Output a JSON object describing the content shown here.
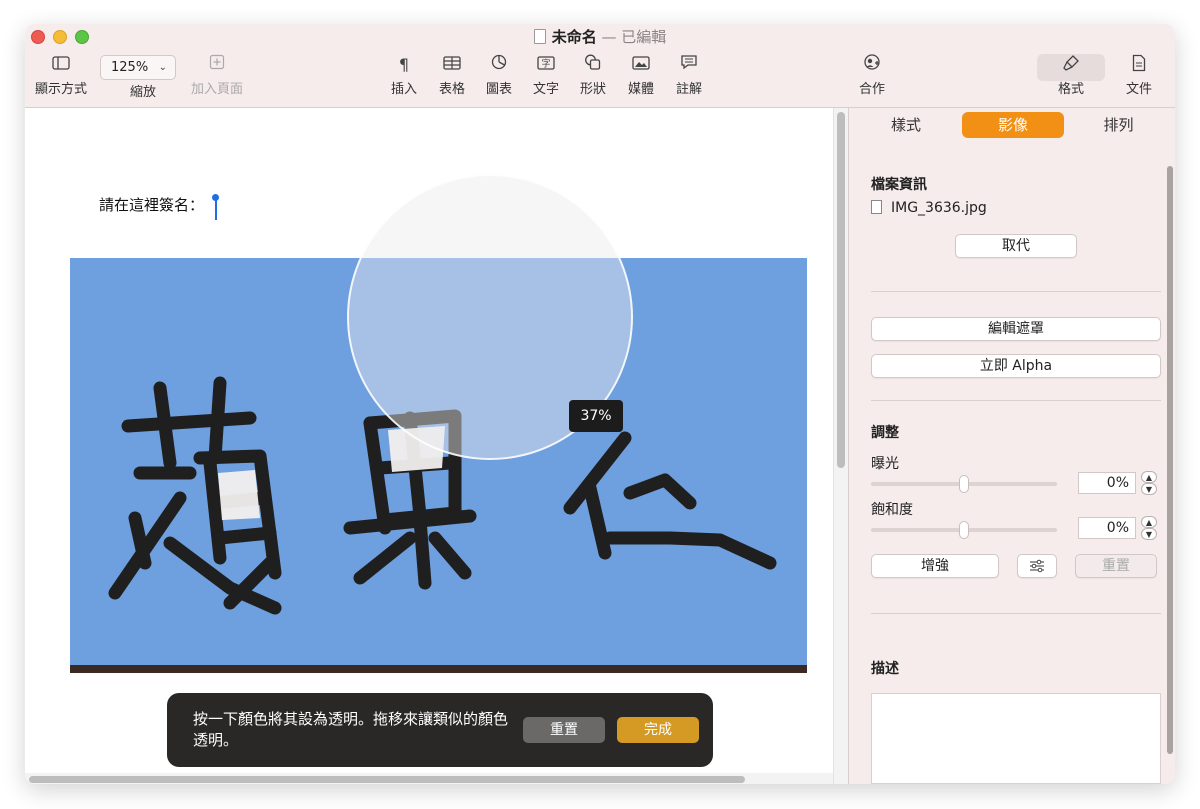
{
  "window": {
    "title": "未命名",
    "title_separator": "—",
    "title_status": "已編輯"
  },
  "toolbar": {
    "view_label": "顯示方式",
    "zoom_value": "125%",
    "zoom_label": "縮放",
    "add_page_label": "加入頁面",
    "insert_label": "插入",
    "table_label": "表格",
    "chart_label": "圖表",
    "text_label": "文字",
    "shape_label": "形狀",
    "media_label": "媒體",
    "comment_label": "註解",
    "collaborate_label": "合作",
    "format_label": "格式",
    "document_label": "文件"
  },
  "document": {
    "sign_prompt": "請在這裡簽名：",
    "magnifier_percent": "37%",
    "image_color": "#6e9fde"
  },
  "hud": {
    "instruction": "按一下顏色將其設為透明。拖移來讓類似的顏色透明。",
    "reset_label": "重置",
    "done_label": "完成"
  },
  "inspector": {
    "tabs": [
      {
        "label": "樣式",
        "active": false
      },
      {
        "label": "影像",
        "active": true
      },
      {
        "label": "排列",
        "active": false
      }
    ],
    "file_info_title": "檔案資訊",
    "file_name": "IMG_3636.jpg",
    "replace_label": "取代",
    "edit_mask_label": "編輯遮罩",
    "instant_alpha_label": "立即 Alpha",
    "adjust_title": "調整",
    "exposure_label": "曝光",
    "exposure_value": "0%",
    "exposure_level": 0.5,
    "saturation_label": "飽和度",
    "saturation_value": "0%",
    "saturation_level": 0.5,
    "enhance_label": "增強",
    "reset_label": "重置",
    "description_title": "描述"
  },
  "colors": {
    "accent_tab": "#f29015",
    "done_button": "#d59a24",
    "toolbar_bg": "#f6ecec"
  }
}
